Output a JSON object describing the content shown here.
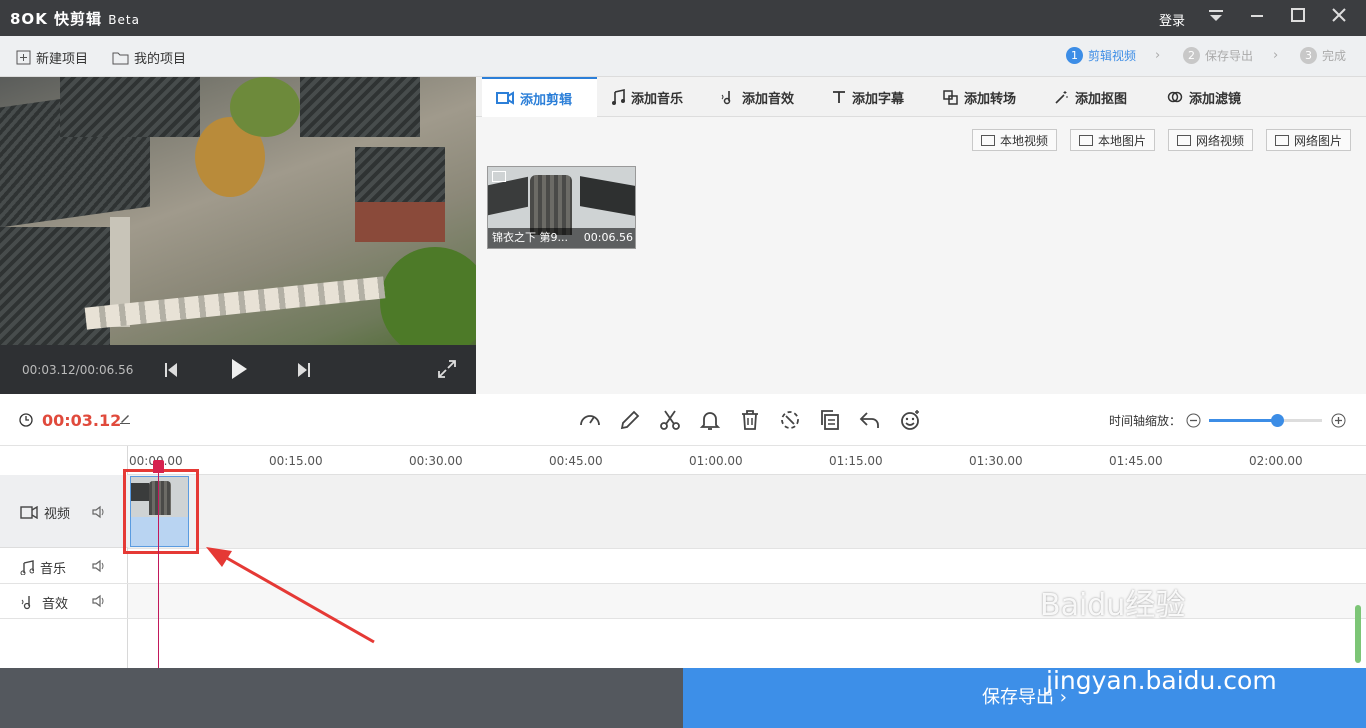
{
  "app": {
    "logo": "8OK 快剪辑",
    "beta": "Beta",
    "login": "登录"
  },
  "menubar": {
    "new_project": "新建项目",
    "my_projects": "我的项目",
    "steps": [
      {
        "num": "1",
        "label": "剪辑视频"
      },
      {
        "num": "2",
        "label": "保存导出"
      },
      {
        "num": "3",
        "label": "完成"
      }
    ]
  },
  "player": {
    "time": "00:03.12/00:06.56"
  },
  "tabs": [
    "添加剪辑",
    "添加音乐",
    "添加音效",
    "添加字幕",
    "添加转场",
    "添加抠图",
    "添加滤镜"
  ],
  "library": {
    "buttons": [
      "本地视频",
      "本地图片",
      "网络视频",
      "网络图片"
    ],
    "clip": {
      "name": "锦衣之下 第9...",
      "duration": "00:06.56"
    }
  },
  "toolbar": {
    "current_time": "00:03.12",
    "zoom_label": "时间轴缩放：",
    "zoom_level": 0.6
  },
  "timeline": {
    "ticks": [
      "00:00.00",
      "00:15.00",
      "00:30.00",
      "00:45.00",
      "01:00.00",
      "01:15.00",
      "01:30.00",
      "01:45.00",
      "02:00.00"
    ],
    "tracks": [
      "视频",
      "音乐",
      "音效"
    ]
  },
  "footer": {
    "export_label": "保存导出 ›"
  },
  "watermark": {
    "brand": "Baidu经验",
    "url": "jingyan.baidu.com"
  },
  "colors": {
    "accent": "#3c8de6",
    "playhead": "#c2185b",
    "highlight": "#e53935",
    "time_red": "#e04a3c"
  }
}
